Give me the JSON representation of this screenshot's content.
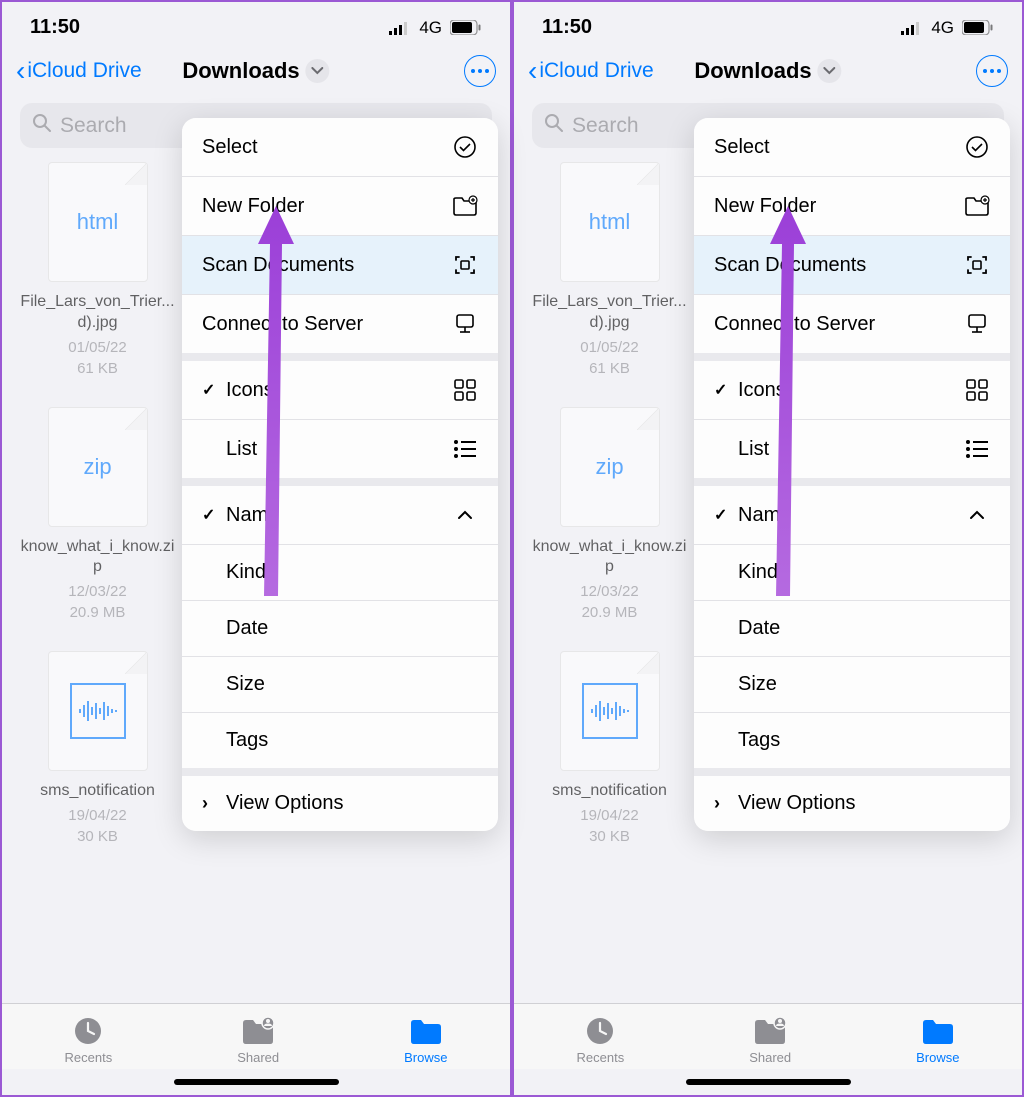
{
  "status": {
    "time": "11:50",
    "network": "4G"
  },
  "nav": {
    "back": "iCloud Drive",
    "title": "Downloads"
  },
  "search": {
    "placeholder": "Search"
  },
  "files": [
    {
      "type_label": "html",
      "name": "File_Lars_von_Trier...d).jpg",
      "date": "01/05/22",
      "size": "61 KB",
      "kind": "html"
    },
    {
      "type_label": "zip",
      "name": "know_what_i_know.zip",
      "date": "12/03/22",
      "size": "20.9 MB",
      "kind": "zip"
    },
    {
      "type_label": "",
      "name": "sms_notification",
      "date": "19/04/22",
      "size": "30 KB",
      "kind": "audio"
    }
  ],
  "menu": {
    "group1": [
      {
        "label": "Select",
        "icon": "select"
      },
      {
        "label": "New Folder",
        "icon": "newfolder"
      },
      {
        "label": "Scan Documents",
        "icon": "scan",
        "highlighted": true
      },
      {
        "label": "Connect to Server",
        "icon": "server"
      }
    ],
    "group2": [
      {
        "label": "Icons",
        "icon": "grid",
        "checked": true
      },
      {
        "label": "List",
        "icon": "list"
      }
    ],
    "group3": [
      {
        "label": "Name",
        "checked": true,
        "chevron": "up"
      },
      {
        "label": "Kind"
      },
      {
        "label": "Date"
      },
      {
        "label": "Size"
      },
      {
        "label": "Tags"
      }
    ],
    "group4": [
      {
        "label": "View Options",
        "expand": ">"
      }
    ]
  },
  "tabs": {
    "recents": "Recents",
    "shared": "Shared",
    "browse": "Browse"
  }
}
